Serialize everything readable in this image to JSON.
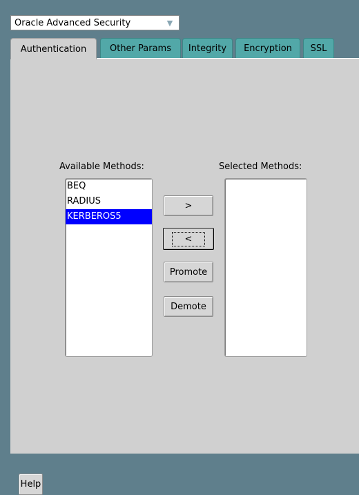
{
  "header": {
    "module_select": "Oracle Advanced Security"
  },
  "tabs": [
    {
      "label": "Authentication",
      "active": true
    },
    {
      "label": "Other Params",
      "active": false
    },
    {
      "label": "Integrity",
      "active": false
    },
    {
      "label": "Encryption",
      "active": false
    },
    {
      "label": "SSL",
      "active": false
    }
  ],
  "authentication": {
    "available_label": "Available Methods:",
    "selected_label": "Selected Methods:",
    "available_methods": [
      "BEQ",
      "RADIUS",
      "KERBEROS5"
    ],
    "selected_available_item": "KERBEROS5",
    "selected_methods": [],
    "buttons": {
      "add": ">",
      "remove": "<",
      "promote": "Promote",
      "demote": "Demote"
    }
  },
  "footer": {
    "help_label": "Help"
  },
  "colors": {
    "background": "#5f7f8c",
    "tab_inactive": "#52a8a8",
    "panel": "#d0d0d0",
    "selection": "#0000ff"
  }
}
